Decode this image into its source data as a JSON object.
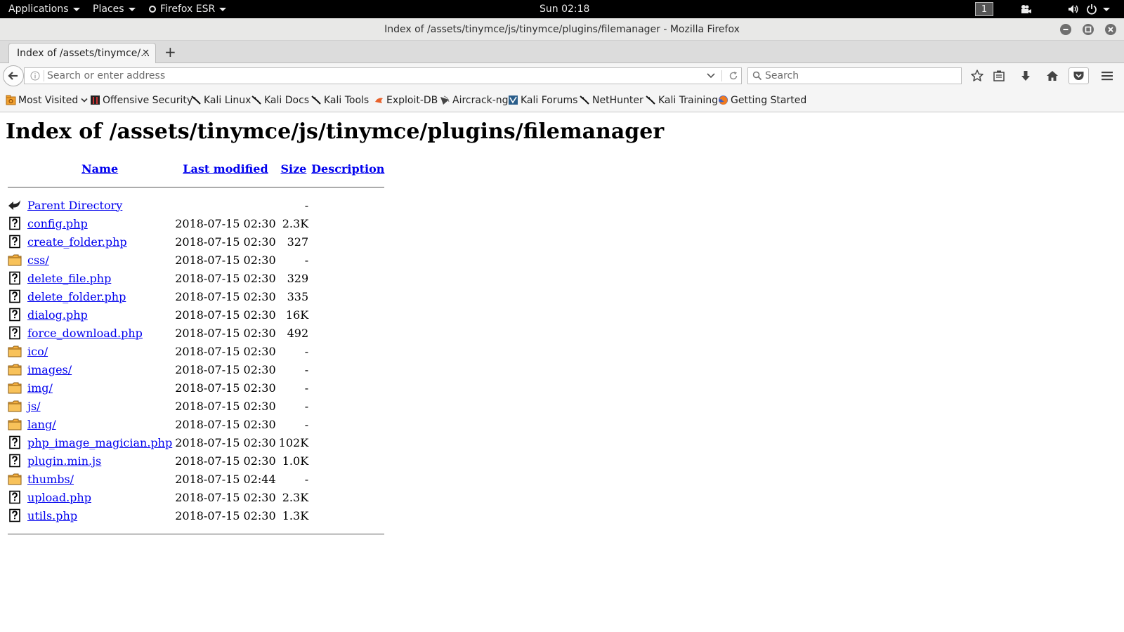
{
  "panel": {
    "applications": "Applications",
    "places": "Places",
    "browser": "Firefox ESR",
    "clock": "Sun 02:18",
    "workspace": "1"
  },
  "window": {
    "title": "Index of /assets/tinymce/js/tinymce/plugins/filemanager - Mozilla Firefox"
  },
  "tabs": [
    {
      "title": "Index of /assets/tinymce/..."
    }
  ],
  "navbar": {
    "url_placeholder": "Search or enter address",
    "search_placeholder": "Search"
  },
  "bookmarks": [
    {
      "label": "Most Visited",
      "icon": "most-visited-icon"
    },
    {
      "label": "Offensive Security",
      "icon": "offsec-icon"
    },
    {
      "label": "Kali Linux",
      "icon": "kali-dragon-icon"
    },
    {
      "label": "Kali Docs",
      "icon": "kali-dragon-icon"
    },
    {
      "label": "Kali Tools",
      "icon": "kali-dragon-icon"
    },
    {
      "label": "Exploit-DB",
      "icon": "exploit-db-icon"
    },
    {
      "label": "Aircrack-ng",
      "icon": "aircrack-icon"
    },
    {
      "label": "Kali Forums",
      "icon": "kali-forums-icon"
    },
    {
      "label": "NetHunter",
      "icon": "kali-dragon-icon"
    },
    {
      "label": "Kali Training",
      "icon": "kali-dragon-icon"
    },
    {
      "label": "Getting Started",
      "icon": "firefox-icon"
    }
  ],
  "page": {
    "heading": "Index of /assets/tinymce/js/tinymce/plugins/filemanager",
    "columns": {
      "name": "Name",
      "last_modified": "Last modified",
      "size": "Size",
      "description": "Description"
    },
    "rows": [
      {
        "icon": "parent-directory-icon",
        "name": "Parent Directory",
        "modified": "",
        "size": "-"
      },
      {
        "icon": "unknown-file-icon",
        "name": "config.php",
        "modified": "2018-07-15 02:30",
        "size": "2.3K"
      },
      {
        "icon": "unknown-file-icon",
        "name": "create_folder.php",
        "modified": "2018-07-15 02:30",
        "size": "327"
      },
      {
        "icon": "folder-icon",
        "name": "css/",
        "modified": "2018-07-15 02:30",
        "size": "-"
      },
      {
        "icon": "unknown-file-icon",
        "name": "delete_file.php",
        "modified": "2018-07-15 02:30",
        "size": "329"
      },
      {
        "icon": "unknown-file-icon",
        "name": "delete_folder.php",
        "modified": "2018-07-15 02:30",
        "size": "335"
      },
      {
        "icon": "unknown-file-icon",
        "name": "dialog.php",
        "modified": "2018-07-15 02:30",
        "size": "16K"
      },
      {
        "icon": "unknown-file-icon",
        "name": "force_download.php",
        "modified": "2018-07-15 02:30",
        "size": "492"
      },
      {
        "icon": "folder-icon",
        "name": "ico/",
        "modified": "2018-07-15 02:30",
        "size": "-"
      },
      {
        "icon": "folder-icon",
        "name": "images/",
        "modified": "2018-07-15 02:30",
        "size": "-"
      },
      {
        "icon": "folder-icon",
        "name": "img/",
        "modified": "2018-07-15 02:30",
        "size": "-"
      },
      {
        "icon": "folder-icon",
        "name": "js/",
        "modified": "2018-07-15 02:30",
        "size": "-"
      },
      {
        "icon": "folder-icon",
        "name": "lang/",
        "modified": "2018-07-15 02:30",
        "size": "-"
      },
      {
        "icon": "unknown-file-icon",
        "name": "php_image_magician.php",
        "modified": "2018-07-15 02:30",
        "size": "102K"
      },
      {
        "icon": "unknown-file-icon",
        "name": "plugin.min.js",
        "modified": "2018-07-15 02:30",
        "size": "1.0K"
      },
      {
        "icon": "folder-icon",
        "name": "thumbs/",
        "modified": "2018-07-15 02:44",
        "size": "-"
      },
      {
        "icon": "unknown-file-icon",
        "name": "upload.php",
        "modified": "2018-07-15 02:30",
        "size": "2.3K"
      },
      {
        "icon": "unknown-file-icon",
        "name": "utils.php",
        "modified": "2018-07-15 02:30",
        "size": "1.3K"
      }
    ]
  }
}
